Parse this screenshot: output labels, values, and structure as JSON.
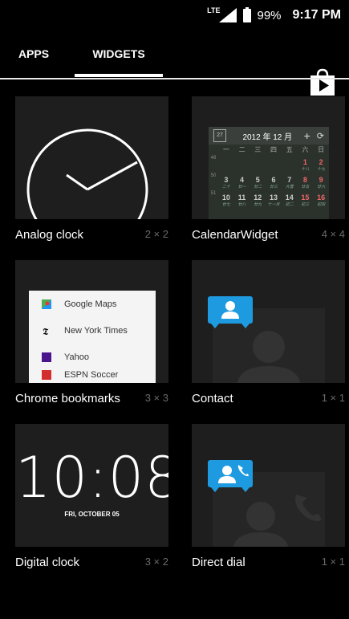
{
  "status_bar": {
    "network": "LTE",
    "battery": "99%",
    "time": "9:17 PM"
  },
  "tabs": [
    {
      "label": "APPS",
      "selected": false
    },
    {
      "label": "WIDGETS",
      "selected": true
    }
  ],
  "store_icon": "play-store-icon",
  "widgets": [
    {
      "name": "Analog clock",
      "dims": "2 × 2"
    },
    {
      "name": "CalendarWidget",
      "dims": "4 × 4"
    },
    {
      "name": "Chrome bookmarks",
      "dims": "3 × 3"
    },
    {
      "name": "Contact",
      "dims": "1 × 1"
    },
    {
      "name": "Digital clock",
      "dims": "3 × 2"
    },
    {
      "name": "Direct dial",
      "dims": "1 × 1"
    }
  ],
  "calendar_preview": {
    "title": "2012 年 12 月",
    "weekdays": [
      "一",
      "二",
      "三",
      "四",
      "五",
      "六",
      "日"
    ],
    "rows": [
      {
        "week": "48",
        "days": [
          "",
          "",
          "",
          "",
          "",
          "1",
          "2"
        ],
        "subs": [
          "",
          "",
          "",
          "",
          "",
          "十八",
          "十九"
        ]
      },
      {
        "week": "50",
        "days": [
          "3",
          "4",
          "5",
          "6",
          "7",
          "8",
          "9"
        ],
        "subs": [
          "二十",
          "廿一",
          "廿二",
          "廿三",
          "大雪",
          "廿五",
          "廿六"
        ]
      },
      {
        "week": "51",
        "days": [
          "10",
          "11",
          "12",
          "13",
          "14",
          "15",
          "16"
        ],
        "subs": [
          "廿七",
          "廿八",
          "廿九",
          "十一月",
          "初二",
          "初三",
          "初四"
        ]
      }
    ]
  },
  "bookmarks_preview": [
    {
      "label": "Google Maps",
      "icon": "maps-icon",
      "color": "#4caf50"
    },
    {
      "label": "New York Times",
      "icon": "nyt-icon",
      "color": "#000000"
    },
    {
      "label": "Yahoo",
      "icon": "yahoo-icon",
      "color": "#4a148c"
    },
    {
      "label": "ESPN Soccer",
      "icon": "espn-icon",
      "color": "#d32f2f"
    }
  ],
  "digital_clock_preview": {
    "time": "10:08",
    "date": "FRI, OCTOBER 05"
  },
  "colors": {
    "accent_blue": "#1e9be0",
    "tile_bg": "#1e1e1e",
    "dims_text": "#6a6a6a"
  }
}
